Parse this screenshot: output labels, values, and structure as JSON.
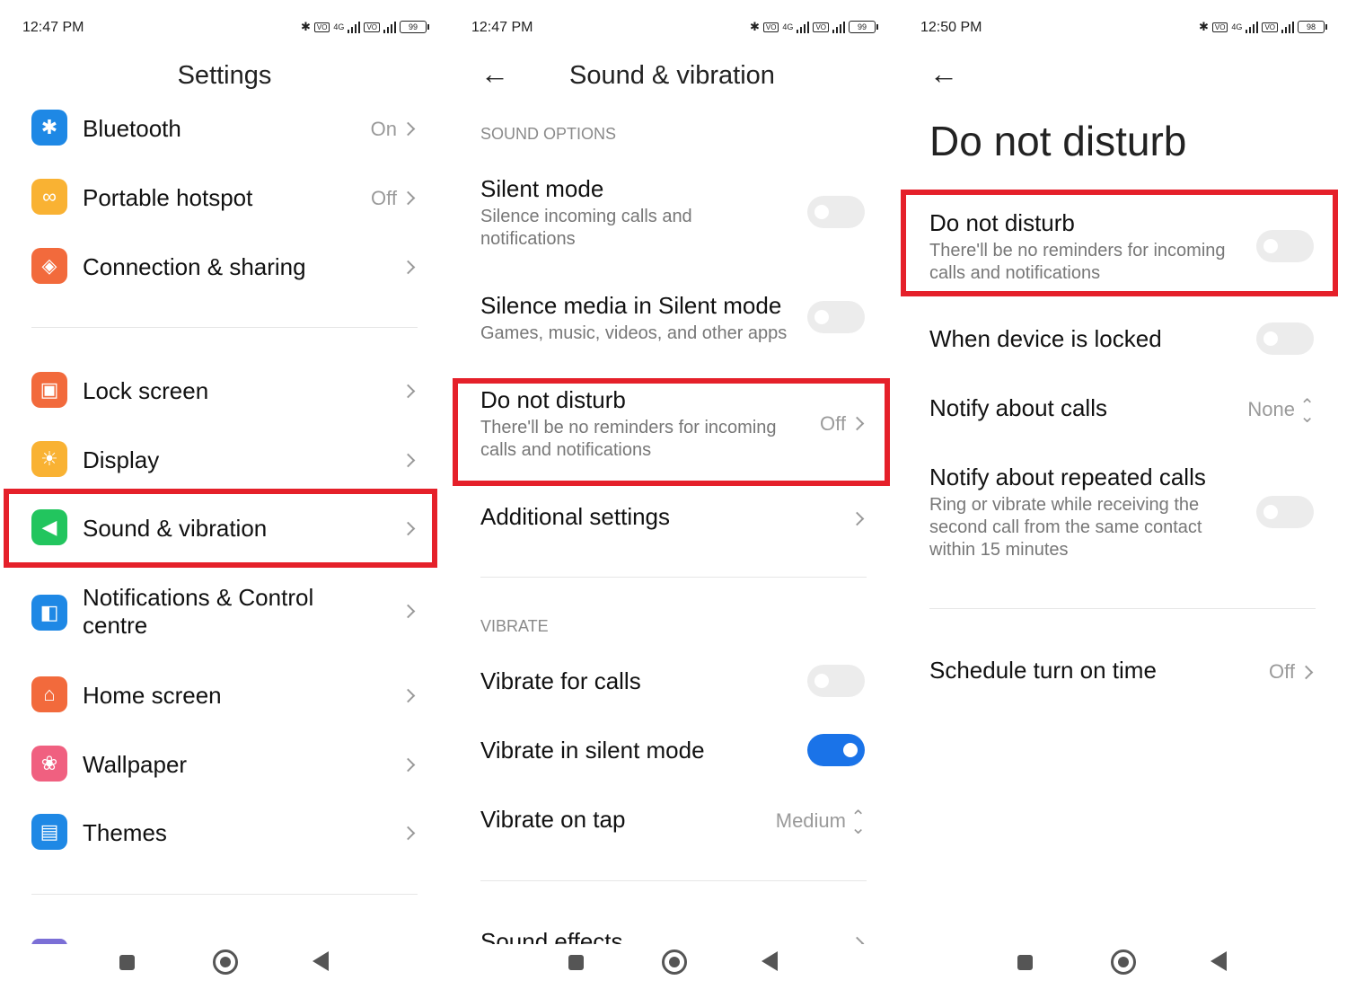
{
  "colors": {
    "accent": "#1a73e8",
    "highlight": "#e5202a"
  },
  "s1": {
    "time": "12:47 PM",
    "battery": "99",
    "network": "4G",
    "title": "Settings",
    "items": [
      {
        "label": "Bluetooth",
        "value": "On",
        "icon": "bluetooth-icon"
      },
      {
        "label": "Portable hotspot",
        "value": "Off",
        "icon": "hotspot-icon"
      },
      {
        "label": "Connection & sharing",
        "value": "",
        "icon": "connection-icon"
      },
      {
        "label": "Lock screen",
        "value": "",
        "icon": "lock-icon"
      },
      {
        "label": "Display",
        "value": "",
        "icon": "sun-icon"
      },
      {
        "label": "Sound & vibration",
        "value": "",
        "icon": "speaker-icon"
      },
      {
        "label": "Notifications & Control centre",
        "value": "",
        "icon": "notification-icon"
      },
      {
        "label": "Home screen",
        "value": "",
        "icon": "home-icon"
      },
      {
        "label": "Wallpaper",
        "value": "",
        "icon": "wallpaper-icon"
      },
      {
        "label": "Themes",
        "value": "",
        "icon": "themes-icon"
      }
    ]
  },
  "s2": {
    "time": "12:47 PM",
    "battery": "99",
    "network": "4G",
    "title": "Sound & vibration",
    "section_sound": "SOUND OPTIONS",
    "silent_title": "Silent mode",
    "silent_sub": "Silence incoming calls and notifications",
    "silence_media_title": "Silence media in Silent mode",
    "silence_media_sub": "Games, music, videos, and other apps",
    "dnd_title": "Do not disturb",
    "dnd_sub": "There'll be no reminders for incoming calls and notifications",
    "dnd_value": "Off",
    "additional": "Additional settings",
    "section_vibrate": "VIBRATE",
    "vibrate_calls": "Vibrate for calls",
    "vibrate_silent": "Vibrate in silent mode",
    "vibrate_tap": "Vibrate on tap",
    "vibrate_tap_value": "Medium",
    "sound_effects": "Sound effects"
  },
  "s3": {
    "time": "12:50 PM",
    "battery": "98",
    "network": "4G",
    "title": "Do not disturb",
    "dnd_title": "Do not disturb",
    "dnd_sub": "There'll be no reminders for incoming calls and notifications",
    "locked": "When device is locked",
    "notify_calls": "Notify about calls",
    "notify_calls_value": "None",
    "repeated_title": "Notify about repeated calls",
    "repeated_sub": "Ring or vibrate while receiving the second call from the same contact within 15 minutes",
    "schedule": "Schedule turn on time",
    "schedule_value": "Off"
  }
}
